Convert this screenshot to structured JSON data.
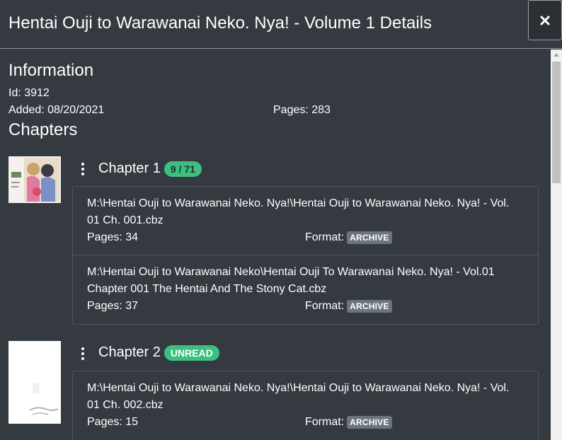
{
  "header": {
    "title": "Hentai Ouji to Warawanai Neko. Nya! - Volume 1 Details",
    "close_icon": "close-icon"
  },
  "information": {
    "heading": "Information",
    "id_text": "Id: 3912",
    "added_text": "Added: 08/20/2021",
    "pages_text": "Pages: 283"
  },
  "chapters": {
    "heading": "Chapters",
    "items": [
      {
        "title": "Chapter 1",
        "badge": "9 / 71",
        "badge_color": "#3cbf7f",
        "files": [
          {
            "path": "M:\\Hentai Ouji to Warawanai Neko. Nya!\\Hentai Ouji to Warawanai Neko. Nya! - Vol. 01 Ch. 001.cbz",
            "pages": "Pages: 34",
            "format_label": "Format:",
            "format": "ARCHIVE"
          },
          {
            "path": "M:\\Hentai Ouji to Warawanai Neko\\Hentai Ouji To Warawanai Neko. Nya! - Vol.01 Chapter 001 The Hentai And The Stony Cat.cbz",
            "pages": "Pages: 37",
            "format_label": "Format:",
            "format": "ARCHIVE"
          }
        ]
      },
      {
        "title": "Chapter 2",
        "badge": "UNREAD",
        "badge_color": "#3cbf7f",
        "files": [
          {
            "path": "M:\\Hentai Ouji to Warawanai Neko. Nya!\\Hentai Ouji to Warawanai Neko. Nya! - Vol. 01 Ch. 002.cbz",
            "pages": "Pages: 15",
            "format_label": "Format:",
            "format": "ARCHIVE"
          }
        ]
      }
    ]
  },
  "colors": {
    "background": "#343a40",
    "badge_green": "#3cbf7f",
    "format_badge": "#6c757d"
  }
}
